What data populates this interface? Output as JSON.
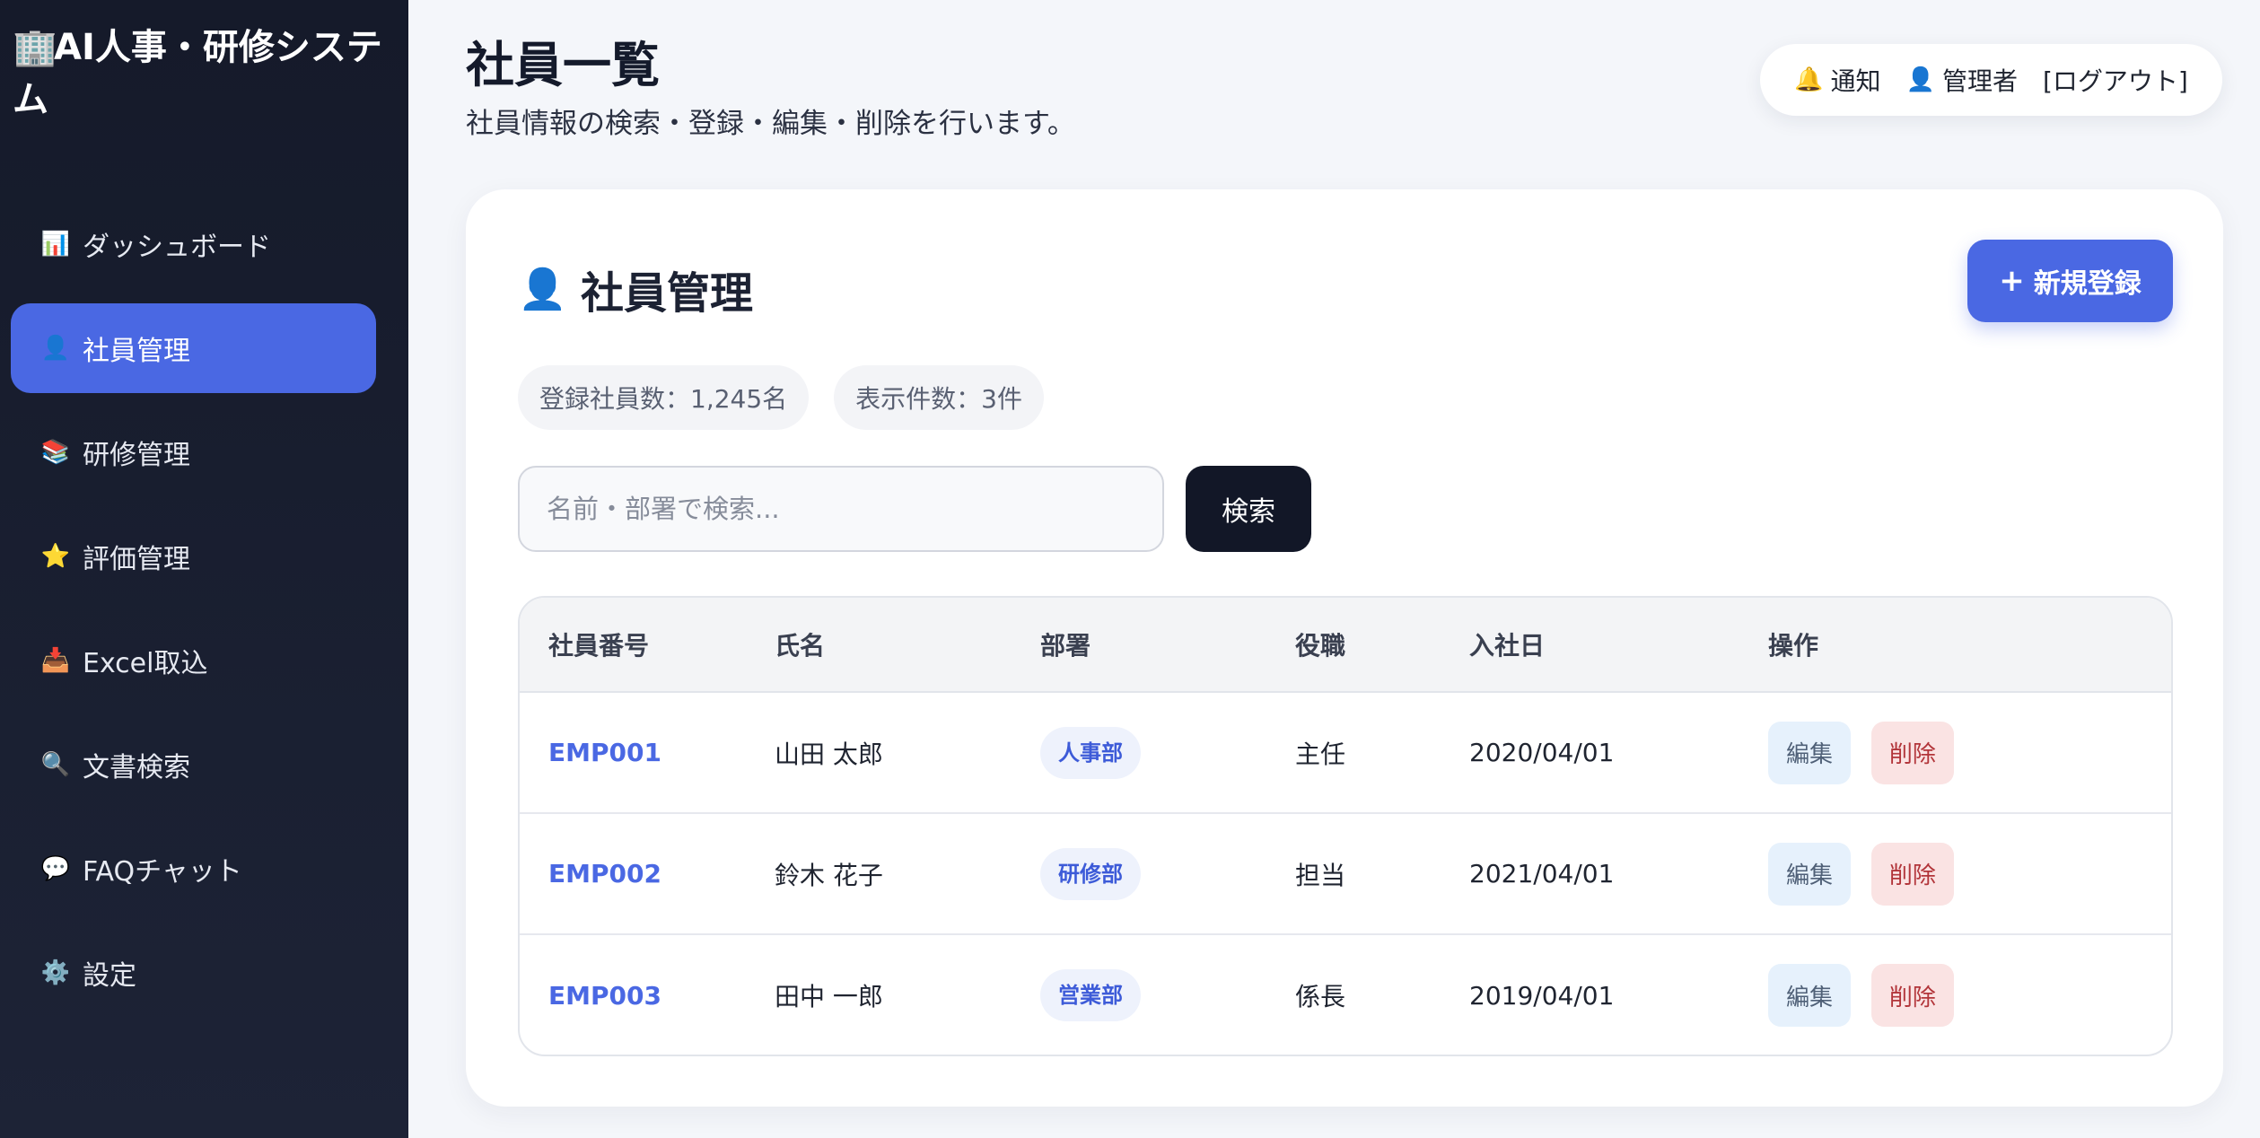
{
  "sidebar": {
    "brand_icon": "🏢",
    "brand_title": "AI人事・研修システム",
    "items": [
      {
        "icon": "📊",
        "icon_name": "chart-icon",
        "label": "ダッシュボード",
        "active": false
      },
      {
        "icon": "👤",
        "icon_name": "user-icon",
        "label": "社員管理",
        "active": true
      },
      {
        "icon": "📚",
        "icon_name": "books-icon",
        "label": "研修管理",
        "active": false
      },
      {
        "icon": "⭐",
        "icon_name": "star-icon",
        "label": "評価管理",
        "active": false
      },
      {
        "icon": "📥",
        "icon_name": "inbox-tray-icon",
        "label": "Excel取込",
        "active": false
      },
      {
        "icon": "🔍",
        "icon_name": "search-icon",
        "label": "文書検索",
        "active": false
      },
      {
        "icon": "💬",
        "icon_name": "speech-bubble-icon",
        "label": "FAQチャット",
        "active": false
      },
      {
        "icon": "⚙️",
        "icon_name": "gear-icon",
        "label": "設定",
        "active": false
      }
    ]
  },
  "header": {
    "title": "社員一覧",
    "subtitle": "社員情報の検索・登録・編集・削除を行います。"
  },
  "topbar": {
    "bell_icon": "🔔",
    "notify_label": "通知",
    "user_icon": "👤",
    "user_label": "管理者",
    "logout_label": "[ログアウト]"
  },
  "card": {
    "icon": "👤",
    "title": "社員管理",
    "new_button_plus": "+",
    "new_button_label": "新規登録",
    "stats": {
      "registered": "登録社員数：1,245名",
      "shown": "表示件数：3件"
    },
    "search": {
      "placeholder": "名前・部署で検索...",
      "value": "",
      "button_label": "検索"
    }
  },
  "table": {
    "headers": {
      "id": "社員番号",
      "name": "氏名",
      "dept": "部署",
      "role": "役職",
      "joined": "入社日",
      "actions": "操作"
    },
    "edit_label": "編集",
    "delete_label": "削除",
    "rows": [
      {
        "id": "EMP001",
        "name": "山田 太郎",
        "dept": "人事部",
        "role": "主任",
        "joined": "2020/04/01"
      },
      {
        "id": "EMP002",
        "name": "鈴木 花子",
        "dept": "研修部",
        "role": "担当",
        "joined": "2021/04/01"
      },
      {
        "id": "EMP003",
        "name": "田中 一郎",
        "dept": "営業部",
        "role": "係長",
        "joined": "2019/04/01"
      }
    ]
  },
  "colors": {
    "accent": "#4a68e3",
    "sidebar_bg": "#151a2a",
    "search_button_bg": "#121727",
    "edit_bg": "#e6f1fc",
    "delete_bg": "#fae3e3"
  }
}
